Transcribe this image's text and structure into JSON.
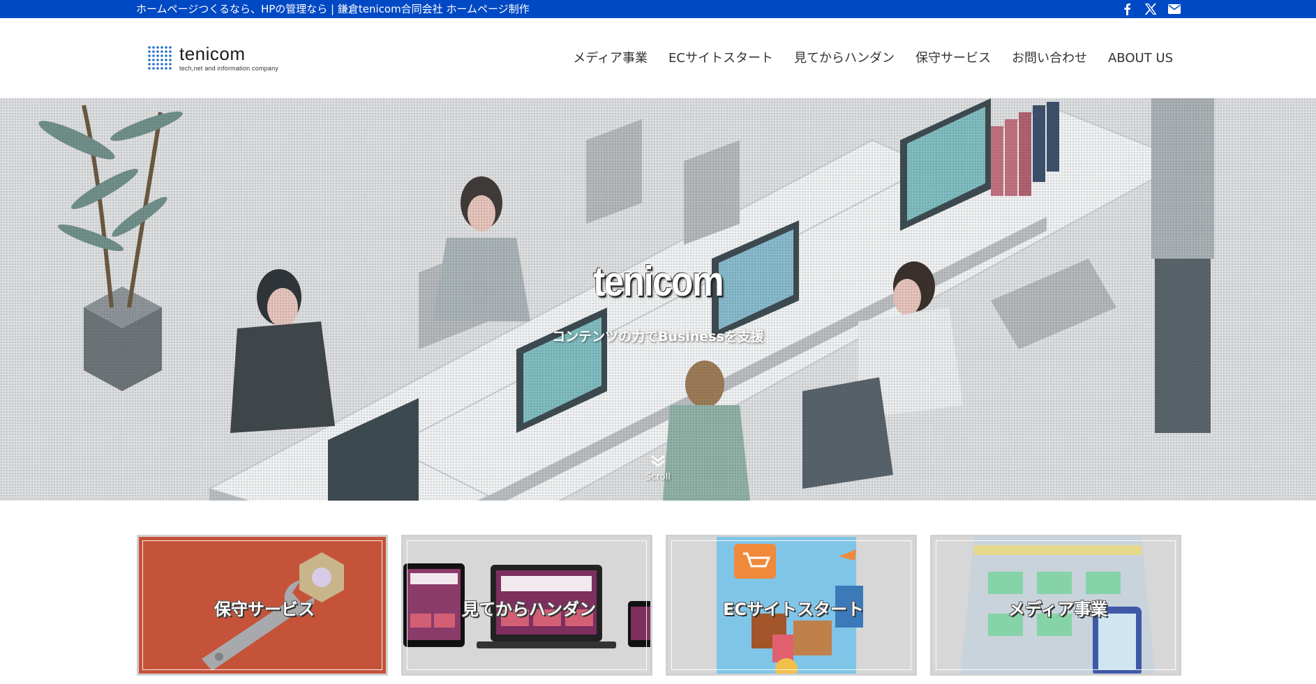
{
  "topbar": {
    "tagline": "ホームページつくるなら、HPの管理なら | 鎌倉tenicom合同会社 ホームページ制作",
    "icons": [
      "facebook-icon",
      "x-icon",
      "mail-icon"
    ],
    "bg_color": "#0049c4"
  },
  "header": {
    "logo_name": "tenicom",
    "logo_tagline": "tech,net and information company",
    "nav": [
      {
        "label": "メディア事業"
      },
      {
        "label": "ECサイトスタート"
      },
      {
        "label": "見てからハンダン"
      },
      {
        "label": "保守サービス"
      },
      {
        "label": "お問い合わせ"
      },
      {
        "label": "ABOUT US"
      }
    ]
  },
  "hero": {
    "title": "tenicom",
    "subtitle": "コンテンツの力でBusinessを支援",
    "scroll_label": "Scroll"
  },
  "cards": [
    {
      "label": "保守サービス",
      "color": "#c5533a"
    },
    {
      "label": "見てからハンダン",
      "color": "#d7d7d7"
    },
    {
      "label": "ECサイトスタート",
      "color": "#d7d7d7"
    },
    {
      "label": "メディア事業",
      "color": "#d7d7d7"
    }
  ]
}
